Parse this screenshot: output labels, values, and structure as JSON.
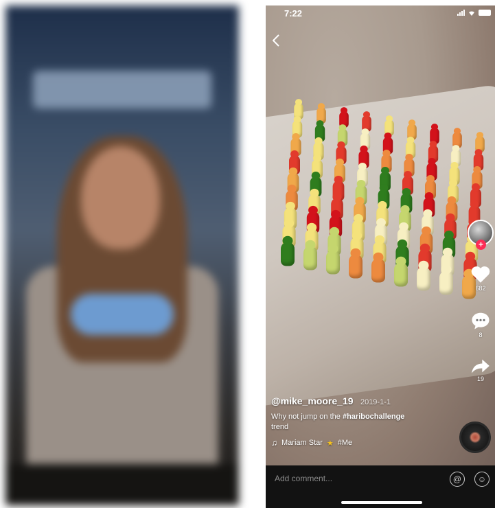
{
  "status_bar": {
    "time": "7:22"
  },
  "icons": {
    "back": "chevron-left-icon",
    "like": "heart-icon",
    "comment": "comment-icon",
    "share": "share-icon",
    "music": "music-note-icon",
    "mention": "at-icon",
    "emoji": "emoji-icon"
  },
  "post": {
    "username": "@mike_moore_19",
    "date": "2019-1-1",
    "caption_prefix": "Why not jump on the",
    "hashtag": "#haribochallenge",
    "caption_suffix": "trend",
    "music_artist": "Mariam Star",
    "music_title": "#Me"
  },
  "actions": {
    "likes": "682",
    "comments": "8",
    "shares": "19"
  },
  "comment_bar": {
    "placeholder": "Add comment..."
  },
  "colors": {
    "accent": "#fe2c55",
    "bar_bg": "#121212"
  }
}
